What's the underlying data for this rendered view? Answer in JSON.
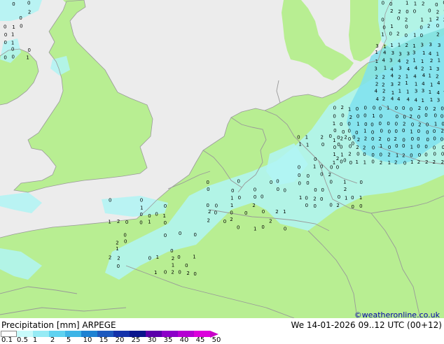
{
  "title_left": "Precipitation [mm]  ARPEGE",
  "title_right": "We 14-01-2026 09..12 UTC (00+12)",
  "credit": "©weatheronline.co.uk",
  "colors": {
    "sea": "#ececec",
    "land": "#b8ee92",
    "border": "#999999",
    "coast": "#9a9a9a",
    "rain_light": "#b0f4f4",
    "rain_mid": "#7ee0ee"
  },
  "legend": {
    "labels": [
      "0.1",
      "0.5",
      "1",
      "2",
      "5",
      "10",
      "15",
      "20",
      "25",
      "30",
      "35",
      "40",
      "45",
      "50"
    ],
    "colors": [
      "#fefefe",
      "#c8fafa",
      "#96ebf5",
      "#5fd2f0",
      "#3cb4e6",
      "#1e82d2",
      "#1e5abe",
      "#1432aa",
      "#0a148c",
      "#5a00aa",
      "#8c00c8",
      "#b400d2",
      "#dc00dc",
      "#c800c8"
    ]
  },
  "numbers_text": "1 2 3 4 0"
}
